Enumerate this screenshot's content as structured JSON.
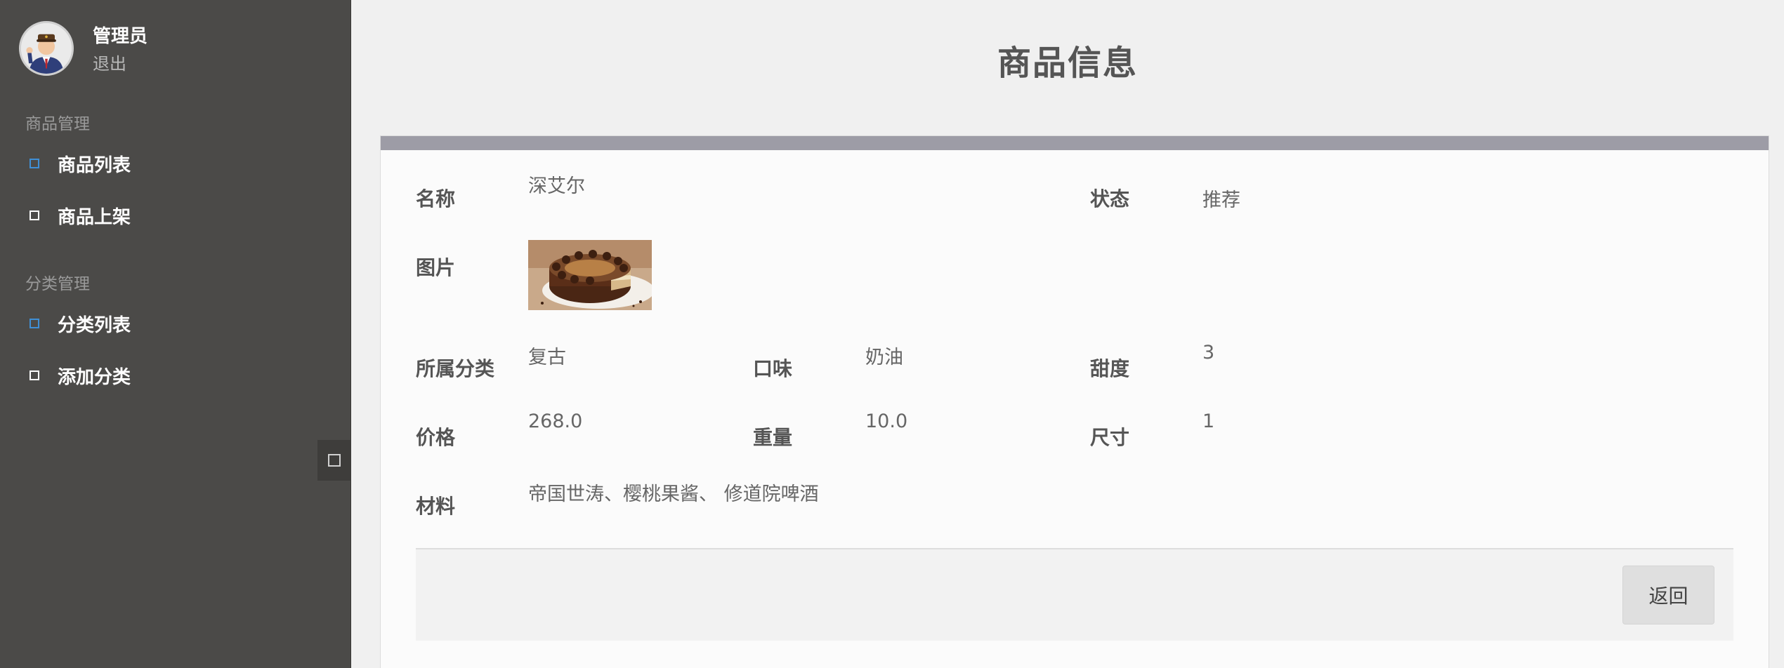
{
  "user": {
    "name": "管理员",
    "logout_label": "退出",
    "avatar_icon": "admin-avatar-icon"
  },
  "sidebar": {
    "groups": [
      {
        "title": "商品管理",
        "items": [
          {
            "label": "商品列表",
            "icon": "square-icon",
            "icon_color": "#3f8fd6"
          },
          {
            "label": "商品上架",
            "icon": "square-icon",
            "icon_color": "#ffffff"
          }
        ]
      },
      {
        "title": "分类管理",
        "items": [
          {
            "label": "分类列表",
            "icon": "square-icon",
            "icon_color": "#3f8fd6"
          },
          {
            "label": "添加分类",
            "icon": "square-icon",
            "icon_color": "#ffffff"
          }
        ]
      }
    ],
    "collapse_icon": "square-icon"
  },
  "main": {
    "title": "商品信息",
    "fields": {
      "name": {
        "label": "名称",
        "value": "深艾尔"
      },
      "status": {
        "label": "状态",
        "value": "推荐"
      },
      "image": {
        "label": "图片",
        "icon": "cake-image"
      },
      "category": {
        "label": "所属分类",
        "value": "复古"
      },
      "flavor": {
        "label": "口味",
        "value": "奶油"
      },
      "sweetness": {
        "label": "甜度",
        "value": "3"
      },
      "price": {
        "label": "价格",
        "value": "268.0"
      },
      "weight": {
        "label": "重量",
        "value": "10.0"
      },
      "size": {
        "label": "尺寸",
        "value": "1"
      },
      "material": {
        "label": "材料",
        "value": "帝国世涛、樱桃果酱、 修道院啤酒"
      }
    },
    "back_label": "返回"
  },
  "colors": {
    "sidebar_bg": "#4b4a48",
    "card_bar": "#9d9ca6",
    "nav_icon_accent": "#3f8fd6"
  }
}
